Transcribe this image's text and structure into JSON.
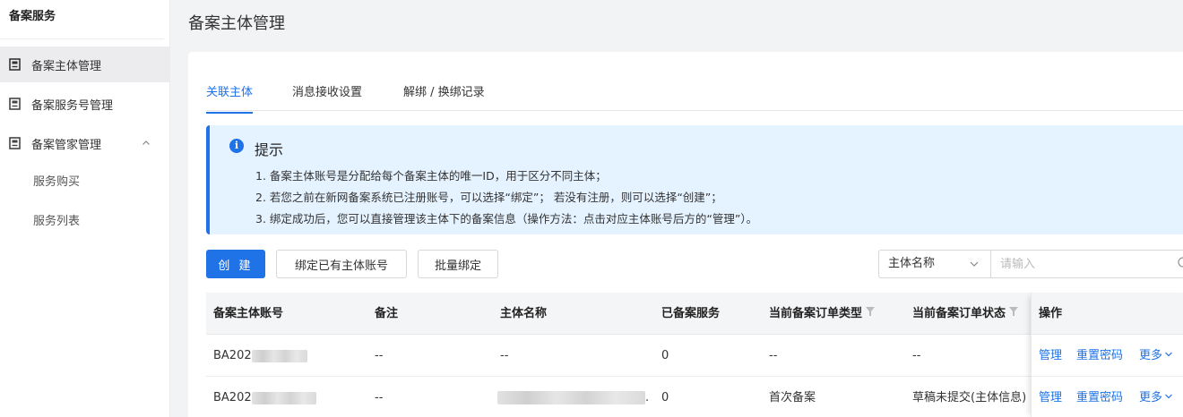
{
  "sidebar": {
    "title": "备案服务",
    "items": [
      {
        "label": "备案主体管理",
        "icon": "document-icon"
      },
      {
        "label": "备案服务号管理",
        "icon": "document-icon"
      },
      {
        "label": "备案管家管理",
        "icon": "document-icon"
      }
    ],
    "subitems": [
      {
        "label": "服务购买"
      },
      {
        "label": "服务列表"
      }
    ]
  },
  "page": {
    "title": "备案主体管理"
  },
  "tabs": [
    {
      "label": "关联主体"
    },
    {
      "label": "消息接收设置"
    },
    {
      "label": "解绑 / 换绑记录"
    }
  ],
  "notice": {
    "title": "提示",
    "icon_glyph": "i",
    "lines": [
      "1. 备案主体账号是分配给每个备案主体的唯一ID，用于区分不同主体；",
      "2. 若您之前在新网备案系统已注册账号，可以选择“绑定”； 若没有注册，则可以选择“创建”；",
      "3. 绑定成功后，您可以直接管理该主体下的备案信息（操作方法：点击对应主体账号后方的“管理”）。"
    ]
  },
  "toolbar": {
    "create_label": "创 建",
    "bind_label": "绑定已有主体账号",
    "batch_bind_label": "批量绑定",
    "search_field": "主体名称",
    "search_placeholder": "请输入"
  },
  "table": {
    "columns": [
      "备案主体账号",
      "备注",
      "主体名称",
      "已备案服务",
      "当前备案订单类型",
      "当前备案订单状态",
      "操作"
    ],
    "rows": [
      {
        "account": "BA202",
        "note": "--",
        "name": "--",
        "services": "0",
        "order_type": "--",
        "order_status": "--",
        "actions": [
          "管理",
          "重置密码",
          "更多"
        ]
      },
      {
        "account": "BA202",
        "note": "--",
        "name": ".",
        "services": "0",
        "order_type": "首次备案",
        "order_status": "草稿未提交(主体信息)",
        "actions": [
          "管理",
          "重置密码",
          "更多"
        ]
      }
    ]
  },
  "colors": {
    "accent": "#1f73e6",
    "notice_bg": "#e5f2ff"
  }
}
